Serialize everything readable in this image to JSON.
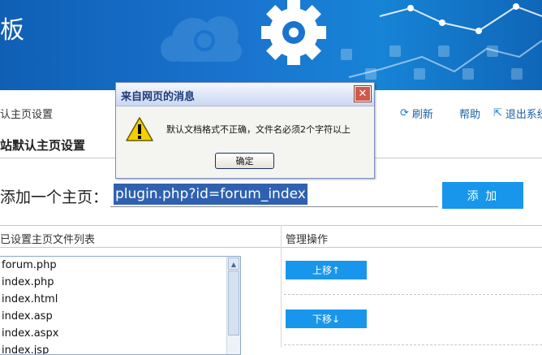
{
  "header": {
    "title": "板"
  },
  "toolbar": {
    "breadcrumb": "认主页设置",
    "refresh": "刷新",
    "help": "帮助",
    "logout": "退出系统"
  },
  "section_title": "站默认主页设置",
  "add_row": {
    "label": "添加一个主页：",
    "input_value": "plugin.php?id=forum_index",
    "button": "添 加"
  },
  "table": {
    "col_files": "已设置主页文件列表",
    "col_actions": "管理操作",
    "files": [
      "forum.php",
      "index.php",
      "index.html",
      "index.asp",
      "index.aspx",
      "index.jsp"
    ],
    "move_up": "上移↑",
    "move_down": "下移↓"
  },
  "dialog": {
    "title": "来自网页的消息",
    "message": "默认文档格式不正确，文件名必须2个字符以上",
    "ok": "确定"
  },
  "colors": {
    "accent": "#1896ec",
    "header": "#1a74cf",
    "selection": "#2f61b0"
  }
}
